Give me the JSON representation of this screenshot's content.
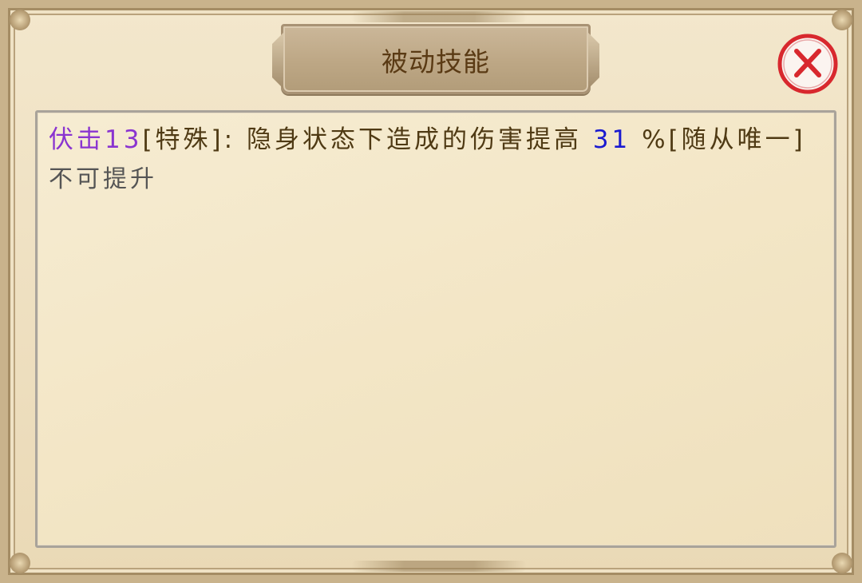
{
  "dialog": {
    "title": "被动技能",
    "close_icon": "close-icon",
    "accent_colors": {
      "skill_name": "#8a34d0",
      "value": "#1a1ad0",
      "text": "#4f3a14",
      "close_red": "#d8282e"
    }
  },
  "skill": {
    "name": "伏击13",
    "desc_prefix": "[特殊]: 隐身状态下造成的伤害提高 ",
    "value": "31",
    "desc_suffix": " %[随从唯一]",
    "status": "不可提升"
  }
}
